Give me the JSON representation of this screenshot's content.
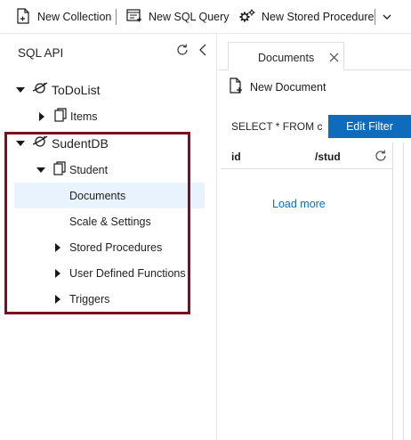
{
  "toolbar": {
    "new_collection": "New Collection",
    "new_sql_query": "New SQL Query",
    "new_stored_procedure": "New Stored Procedure",
    "icons": [
      "new-collection-icon",
      "new-sql-query-icon",
      "new-stored-procedure-icon",
      "chevron-down-icon"
    ]
  },
  "sidebar": {
    "title": "SQL API",
    "tree": {
      "db1": {
        "label": "ToDoList",
        "expanded": true
      },
      "db1_items": {
        "label": "Items",
        "expanded": false
      },
      "db2": {
        "label": "SudentDB",
        "expanded": true
      },
      "db2_student": {
        "label": "Student",
        "expanded": true
      },
      "documents": {
        "label": "Documents",
        "selected": true
      },
      "scale_settings": {
        "label": "Scale & Settings"
      },
      "stored_procedures": {
        "label": "Stored Procedures"
      },
      "udfs": {
        "label": "User Defined Functions"
      },
      "triggers": {
        "label": "Triggers"
      }
    },
    "highlight_color": "#7b0f1e"
  },
  "main": {
    "tab": {
      "label": "Documents"
    },
    "new_document": "New Document",
    "filter": {
      "query": "SELECT * FROM c",
      "edit_button": "Edit Filter"
    },
    "grid": {
      "columns": [
        "id",
        "/stud"
      ],
      "load_more": "Load more"
    },
    "accent_color": "#0f6cbd"
  }
}
